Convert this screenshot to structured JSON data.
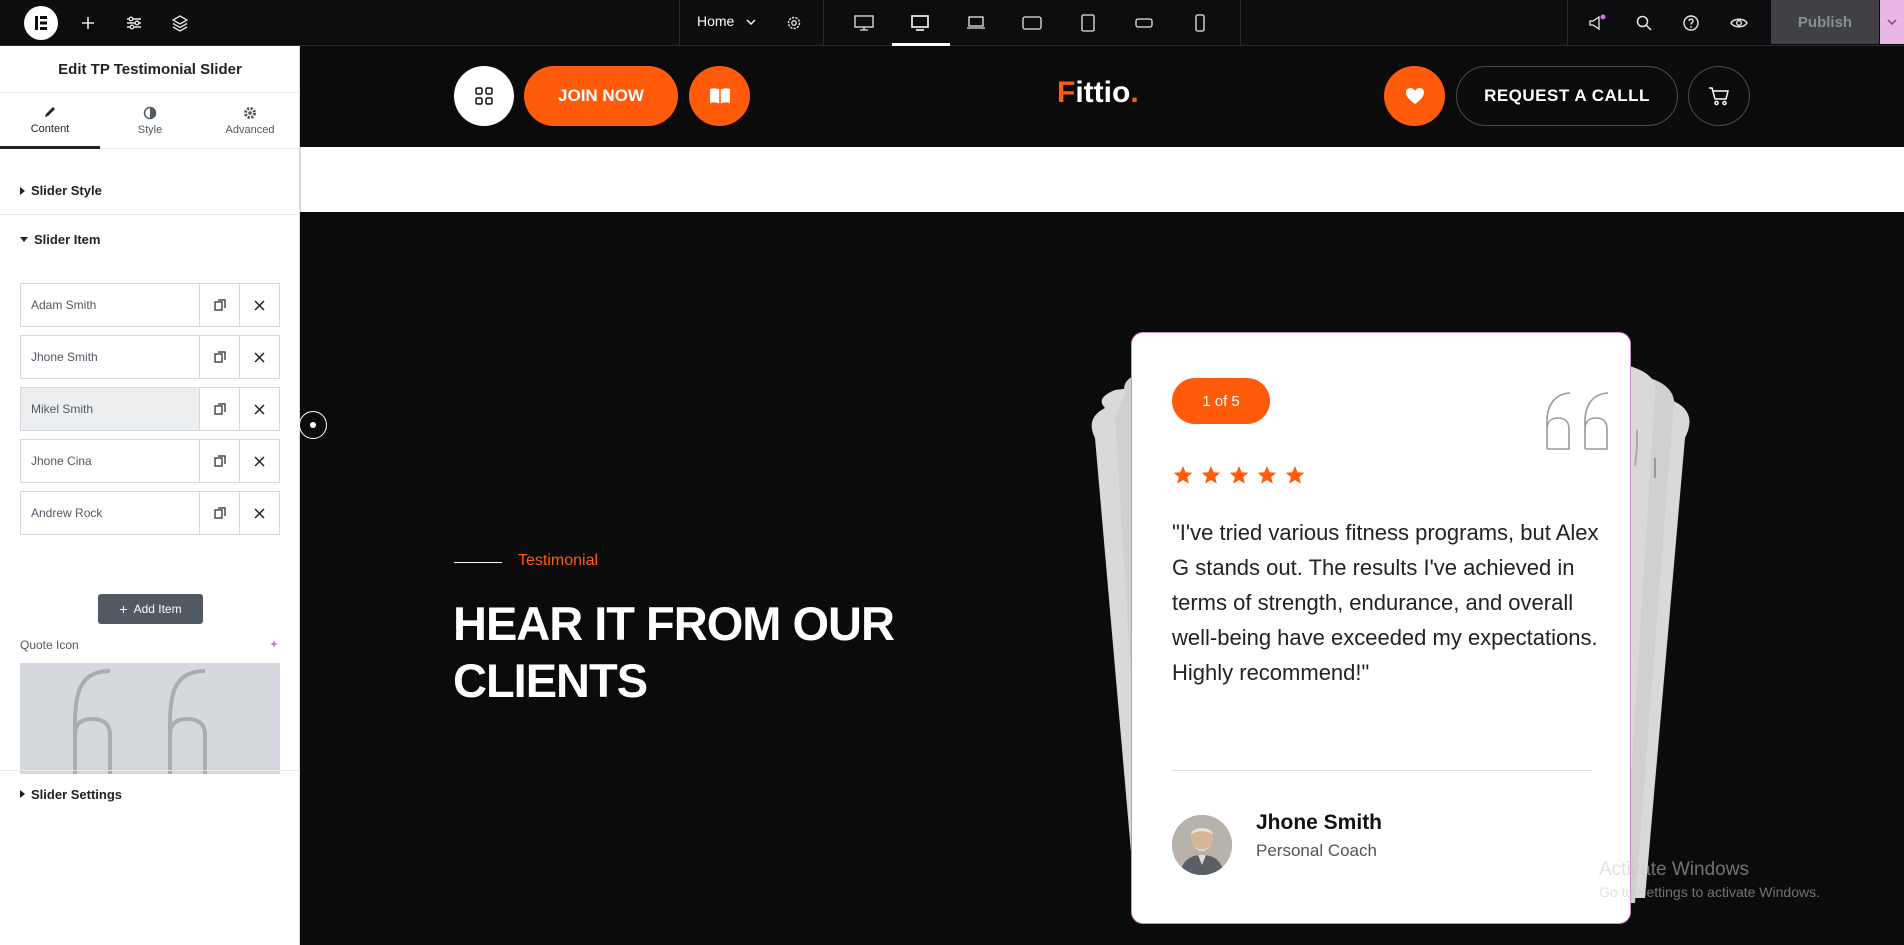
{
  "topbar": {
    "page_name": "Home",
    "publish_label": "Publish"
  },
  "panel": {
    "title": "Edit TP Testimonial Slider",
    "tabs": [
      {
        "label": "Content",
        "icon": "pencil-icon",
        "active": true
      },
      {
        "label": "Style",
        "icon": "contrast-icon",
        "active": false
      },
      {
        "label": "Advanced",
        "icon": "gear-icon",
        "active": false
      }
    ],
    "sections": {
      "slider_style": "Slider Style",
      "slider_item": "Slider Item",
      "slider_settings": "Slider Settings"
    },
    "items": [
      "Adam Smith",
      "Jhone Smith",
      "Mikel Smith",
      "Jhone Cina",
      "Andrew Rock"
    ],
    "add_item_label": "Add Item",
    "quote_icon_label": "Quote Icon"
  },
  "site": {
    "join_label": "JOIN NOW",
    "brand_first": "F",
    "brand_rest": "ittio",
    "brand_dot": ".",
    "request_label": "REQUEST A CALLL",
    "eyebrow": "Testimonial",
    "heading": "HEAR IT FROM OUR CLIENTS",
    "accent_color": "#ff5b0a"
  },
  "testimonial": {
    "counter": "1 of 5",
    "rating": 5,
    "text": "\"I've tried various fitness programs, but Alex G stands out. The results I've achieved in terms of strength, endurance, and overall well-being have exceeded my expectations. Highly recommend!\"",
    "author": "Jhone Smith",
    "role": "Personal Coach"
  },
  "watermark": {
    "line1": "Activate Windows",
    "line2": "Go to Settings to activate Windows."
  }
}
